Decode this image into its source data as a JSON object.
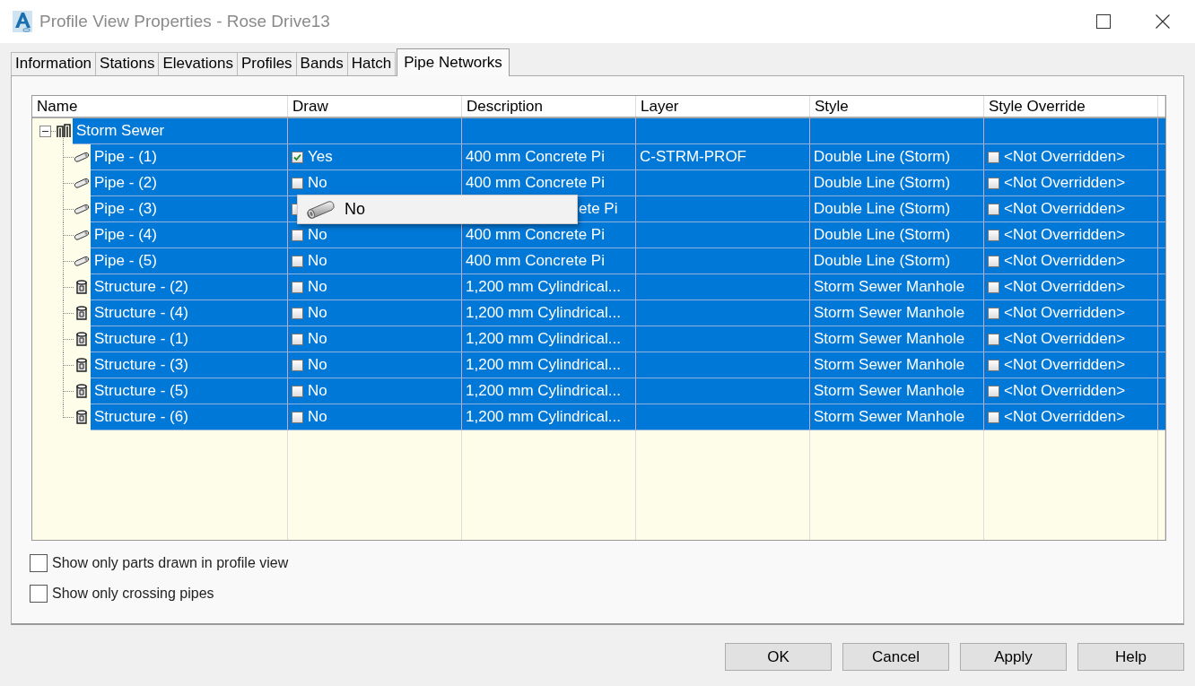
{
  "window": {
    "title": "Profile View Properties - Rose Drive13"
  },
  "tabs": [
    {
      "label": "Information",
      "selected": false
    },
    {
      "label": "Stations",
      "selected": false
    },
    {
      "label": "Elevations",
      "selected": false
    },
    {
      "label": "Profiles",
      "selected": false
    },
    {
      "label": "Bands",
      "selected": false
    },
    {
      "label": "Hatch",
      "selected": false
    },
    {
      "label": "Pipe Networks",
      "selected": true
    }
  ],
  "table": {
    "columns": [
      "Name",
      "Draw",
      "Description",
      "Layer",
      "Style",
      "Style Override"
    ],
    "tree": {
      "name": "Storm Sewer",
      "kind": "network",
      "expanded": true,
      "selected": true,
      "children": [
        {
          "name": "Pipe - (1)",
          "kind": "pipe",
          "selected": true,
          "draw": {
            "checked": true,
            "label": "Yes"
          },
          "description": "400 mm Concrete Pi",
          "layer": "C-STRM-PROF",
          "style": "Double Line (Storm)",
          "override": {
            "checked": false,
            "label": "<Not Overridden>"
          }
        },
        {
          "name": "Pipe - (2)",
          "kind": "pipe",
          "selected": true,
          "draw": {
            "checked": false,
            "label": "No"
          },
          "description": "400 mm Concrete Pi",
          "style": "Double Line (Storm)",
          "override": {
            "checked": false,
            "label": "<Not Overridden>"
          }
        },
        {
          "name": "Pipe - (3)",
          "kind": "pipe",
          "selected": true,
          "draw": {
            "checked": false
          },
          "tooltip": {
            "label": "No"
          },
          "description": "ete Pi",
          "style": "Double Line (Storm)",
          "override": {
            "checked": false,
            "label": "<Not Overridden>"
          }
        },
        {
          "name": "Pipe - (4)",
          "kind": "pipe",
          "selected": true,
          "draw": {
            "checked": false,
            "label": "No"
          },
          "description": "400 mm Concrete Pi",
          "style": "Double Line (Storm)",
          "override": {
            "checked": false,
            "label": "<Not Overridden>"
          }
        },
        {
          "name": "Pipe - (5)",
          "kind": "pipe",
          "selected": true,
          "draw": {
            "checked": false,
            "label": "No"
          },
          "description": "400 mm Concrete Pi",
          "style": "Double Line (Storm)",
          "override": {
            "checked": false,
            "label": "<Not Overridden>"
          }
        },
        {
          "name": "Structure - (2)",
          "kind": "structure",
          "selected": true,
          "draw": {
            "checked": false,
            "label": "No"
          },
          "description": "1,200 mm Cylindrical...",
          "style": "Storm Sewer Manhole",
          "override": {
            "checked": false,
            "label": "<Not Overridden>"
          }
        },
        {
          "name": "Structure - (4)",
          "kind": "structure",
          "selected": true,
          "draw": {
            "checked": false,
            "label": "No"
          },
          "description": "1,200 mm Cylindrical...",
          "style": "Storm Sewer Manhole",
          "override": {
            "checked": false,
            "label": "<Not Overridden>"
          }
        },
        {
          "name": "Structure - (1)",
          "kind": "structure",
          "selected": true,
          "draw": {
            "checked": false,
            "label": "No"
          },
          "description": "1,200 mm Cylindrical...",
          "style": "Storm Sewer Manhole",
          "override": {
            "checked": false,
            "label": "<Not Overridden>"
          }
        },
        {
          "name": "Structure - (3)",
          "kind": "structure",
          "selected": true,
          "draw": {
            "checked": false,
            "label": "No"
          },
          "description": "1,200 mm Cylindrical...",
          "style": "Storm Sewer Manhole",
          "override": {
            "checked": false,
            "label": "<Not Overridden>"
          }
        },
        {
          "name": "Structure - (5)",
          "kind": "structure",
          "selected": true,
          "draw": {
            "checked": false,
            "label": "No"
          },
          "description": "1,200 mm Cylindrical...",
          "style": "Storm Sewer Manhole",
          "override": {
            "checked": false,
            "label": "<Not Overridden>"
          }
        },
        {
          "name": "Structure - (6)",
          "kind": "structure",
          "selected": true,
          "draw": {
            "checked": false,
            "label": "No"
          },
          "description": "1,200 mm Cylindrical...",
          "style": "Storm Sewer Manhole",
          "override": {
            "checked": false,
            "label": "<Not Overridden>"
          }
        }
      ]
    }
  },
  "options": [
    {
      "label": "Show only parts drawn in profile view",
      "checked": false
    },
    {
      "label": "Show only crossing pipes",
      "checked": false
    }
  ],
  "buttons": [
    "OK",
    "Cancel",
    "Apply",
    "Help"
  ]
}
